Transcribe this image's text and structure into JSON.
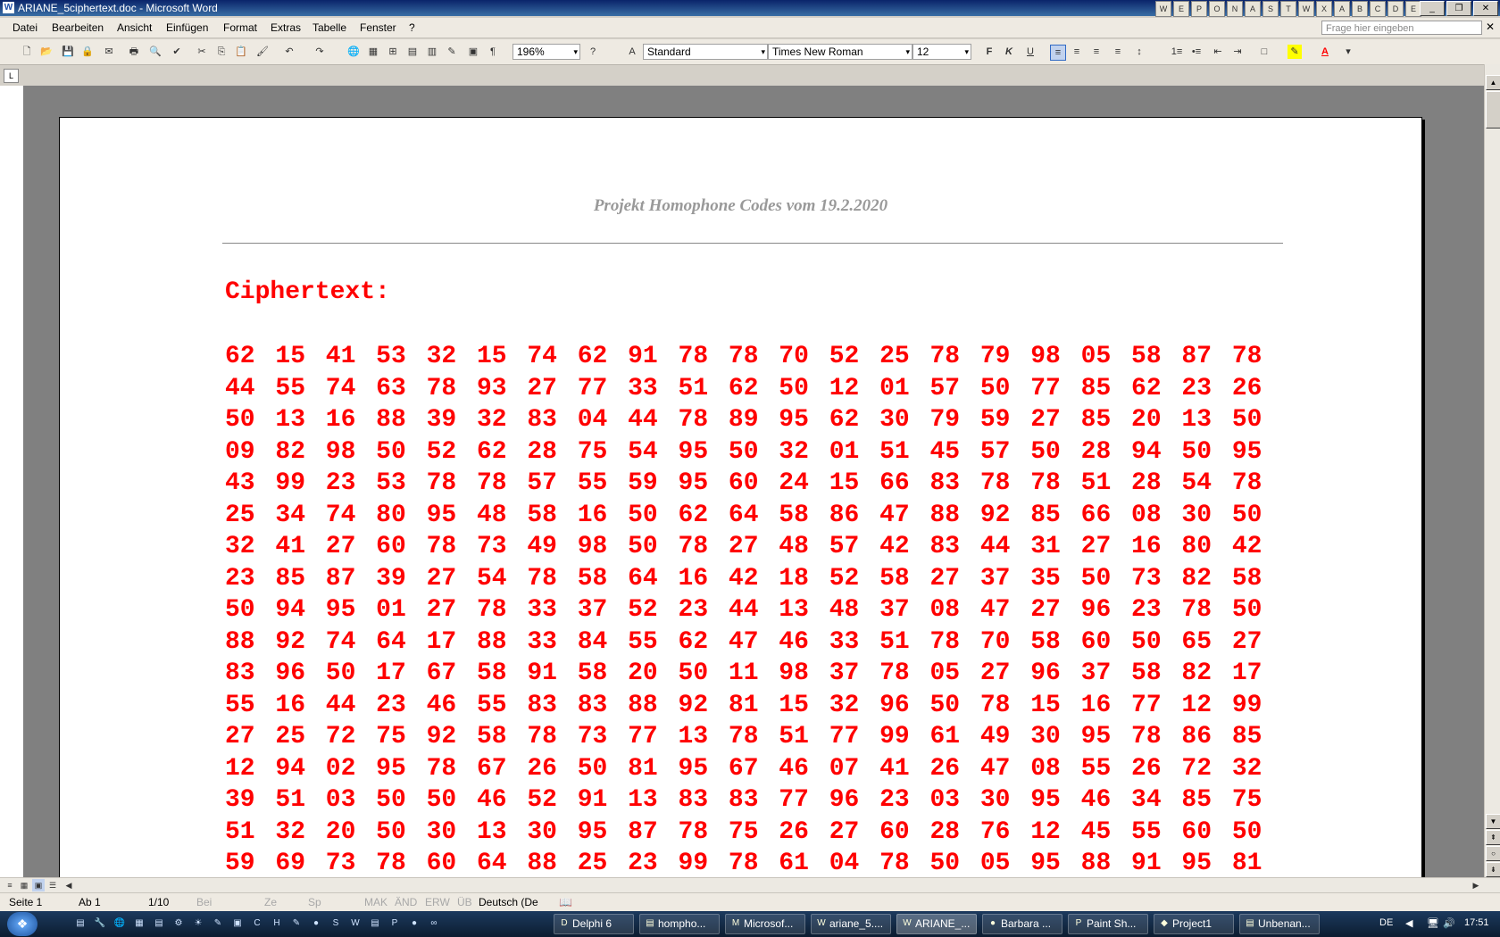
{
  "window": {
    "title": "ARIANE_5ciphertext.doc - Microsoft Word",
    "tray_icons": [
      "W",
      "E",
      "P",
      "O",
      "N",
      "A",
      "S",
      "T",
      "W",
      "X",
      "A",
      "B",
      "C",
      "D",
      "E"
    ],
    "controls": [
      "_",
      "❐",
      "✕"
    ]
  },
  "menu": {
    "items": [
      "Datei",
      "Bearbeiten",
      "Ansicht",
      "Einfügen",
      "Format",
      "Extras",
      "Tabelle",
      "Fenster",
      "?"
    ],
    "ask_placeholder": "Frage hier eingeben",
    "close_glyph": "✕"
  },
  "toolbar": {
    "zoom": "196%",
    "style": "Standard",
    "font": "Times New Roman",
    "size": "12",
    "bold": "F",
    "italic": "K",
    "underline": "U",
    "icons": {
      "new": "🗋",
      "open": "📂",
      "save": "💾",
      "permission": "🔒",
      "email": "✉",
      "print": "🖶",
      "preview": "🔍",
      "spell": "✔",
      "cut": "✂",
      "copy": "⎘",
      "paste": "📋",
      "painter": "🖌",
      "undo": "↶",
      "redo": "↷",
      "hyperlink": "🌐",
      "tables": "▦",
      "insert_table": "⊞",
      "excel": "▤",
      "columns": "▥",
      "drawing": "✎",
      "docmap": "▣",
      "pilcrow": "¶",
      "help": "?",
      "style_icon": "A",
      "align_left": "≡",
      "center": "≡",
      "align_right": "≡",
      "justify": "≡",
      "line_spacing": "↕",
      "numbering": "1≡",
      "bullets": "•≡",
      "dec_indent": "⇤",
      "inc_indent": "⇥",
      "border": "□",
      "highlight": "✎",
      "font_color": "A",
      "more": "▾"
    }
  },
  "document": {
    "header": "Projekt Homophone Codes vom 19.2.2020",
    "heading": "Ciphertext:",
    "rows": [
      [
        "62",
        "15",
        "41",
        "53",
        "32",
        "15",
        "74",
        "62",
        "91",
        "78",
        "78",
        "70",
        "52",
        "25",
        "78",
        "79",
        "98",
        "05",
        "58",
        "87",
        "78"
      ],
      [
        "44",
        "55",
        "74",
        "63",
        "78",
        "93",
        "27",
        "77",
        "33",
        "51",
        "62",
        "50",
        "12",
        "01",
        "57",
        "50",
        "77",
        "85",
        "62",
        "23",
        "26"
      ],
      [
        "50",
        "13",
        "16",
        "88",
        "39",
        "32",
        "83",
        "04",
        "44",
        "78",
        "89",
        "95",
        "62",
        "30",
        "79",
        "59",
        "27",
        "85",
        "20",
        "13",
        "50"
      ],
      [
        "09",
        "82",
        "98",
        "50",
        "52",
        "62",
        "28",
        "75",
        "54",
        "95",
        "50",
        "32",
        "01",
        "51",
        "45",
        "57",
        "50",
        "28",
        "94",
        "50",
        "95"
      ],
      [
        "43",
        "99",
        "23",
        "53",
        "78",
        "78",
        "57",
        "55",
        "59",
        "95",
        "60",
        "24",
        "15",
        "66",
        "83",
        "78",
        "78",
        "51",
        "28",
        "54",
        "78"
      ],
      [
        "25",
        "34",
        "74",
        "80",
        "95",
        "48",
        "58",
        "16",
        "50",
        "62",
        "64",
        "58",
        "86",
        "47",
        "88",
        "92",
        "85",
        "66",
        "08",
        "30",
        "50"
      ],
      [
        "32",
        "41",
        "27",
        "60",
        "78",
        "73",
        "49",
        "98",
        "50",
        "78",
        "27",
        "48",
        "57",
        "42",
        "83",
        "44",
        "31",
        "27",
        "16",
        "80",
        "42"
      ],
      [
        "23",
        "85",
        "87",
        "39",
        "27",
        "54",
        "78",
        "58",
        "64",
        "16",
        "42",
        "18",
        "52",
        "58",
        "27",
        "37",
        "35",
        "50",
        "73",
        "82",
        "58"
      ],
      [
        "50",
        "94",
        "95",
        "01",
        "27",
        "78",
        "33",
        "37",
        "52",
        "23",
        "44",
        "13",
        "48",
        "37",
        "08",
        "47",
        "27",
        "96",
        "23",
        "78",
        "50"
      ],
      [
        "88",
        "92",
        "74",
        "64",
        "17",
        "88",
        "33",
        "84",
        "55",
        "62",
        "47",
        "46",
        "33",
        "51",
        "78",
        "70",
        "58",
        "60",
        "50",
        "65",
        "27"
      ],
      [
        "83",
        "96",
        "50",
        "17",
        "67",
        "58",
        "91",
        "58",
        "20",
        "50",
        "11",
        "98",
        "37",
        "78",
        "05",
        "27",
        "96",
        "37",
        "58",
        "82",
        "17"
      ],
      [
        "55",
        "16",
        "44",
        "23",
        "46",
        "55",
        "83",
        "83",
        "88",
        "92",
        "81",
        "15",
        "32",
        "96",
        "50",
        "78",
        "15",
        "16",
        "77",
        "12",
        "99"
      ],
      [
        "27",
        "25",
        "72",
        "75",
        "92",
        "58",
        "78",
        "73",
        "77",
        "13",
        "78",
        "51",
        "77",
        "99",
        "61",
        "49",
        "30",
        "95",
        "78",
        "86",
        "85"
      ],
      [
        "12",
        "94",
        "02",
        "95",
        "78",
        "67",
        "26",
        "50",
        "81",
        "95",
        "67",
        "46",
        "07",
        "41",
        "26",
        "47",
        "08",
        "55",
        "26",
        "72",
        "32"
      ],
      [
        "39",
        "51",
        "03",
        "50",
        "50",
        "46",
        "52",
        "91",
        "13",
        "83",
        "83",
        "77",
        "96",
        "23",
        "03",
        "30",
        "95",
        "46",
        "34",
        "85",
        "75"
      ],
      [
        "51",
        "32",
        "20",
        "50",
        "30",
        "13",
        "30",
        "95",
        "87",
        "78",
        "75",
        "26",
        "27",
        "60",
        "28",
        "76",
        "12",
        "45",
        "55",
        "60",
        "50"
      ],
      [
        "59",
        "69",
        "73",
        "78",
        "60",
        "64",
        "88",
        "25",
        "23",
        "99",
        "78",
        "61",
        "04",
        "78",
        "50",
        "05",
        "95",
        "88",
        "91",
        "95",
        "81"
      ]
    ]
  },
  "scrollbar": {
    "up": "▲",
    "down": "▼",
    "prev_page": "⇞",
    "select_object": "○",
    "next_page": "⇟",
    "left": "◀",
    "right": "▶"
  },
  "status": {
    "page": "Seite 1",
    "section": "Ab 1",
    "pages": "1/10",
    "at": "Bei",
    "line": "Ze",
    "col": "Sp",
    "rec": "MAK",
    "trk": "ÄND",
    "ext": "ERW",
    "ovr": "ÜB",
    "language": "Deutsch (De",
    "spell_icon": "📖"
  },
  "taskbar": {
    "start_glyph": "❖",
    "quicklaunch": [
      "▤",
      "🔧",
      "🌐",
      "▦",
      "▤",
      "⚙",
      "☀",
      "✎",
      "▣",
      "C",
      "H",
      "✎",
      "●",
      "S",
      "W",
      "▤",
      "P",
      "●",
      "∞"
    ],
    "tasks": [
      {
        "label": "Delphi 6",
        "icon": "D"
      },
      {
        "label": "hompho...",
        "icon": "▤"
      },
      {
        "label": "Microsof...",
        "icon": "M"
      },
      {
        "label": "ariane_5....",
        "icon": "W"
      },
      {
        "label": "ARIANE_...",
        "icon": "W"
      },
      {
        "label": "Barbara ...",
        "icon": "●"
      },
      {
        "label": "Paint Sh...",
        "icon": "P"
      },
      {
        "label": "Project1",
        "icon": "◆"
      },
      {
        "label": "Unbenan...",
        "icon": "▤"
      }
    ],
    "lang": "DE",
    "tray_arrow": "◀",
    "tray_icons": [
      "🖥",
      "🔊"
    ],
    "time": "17:51"
  }
}
